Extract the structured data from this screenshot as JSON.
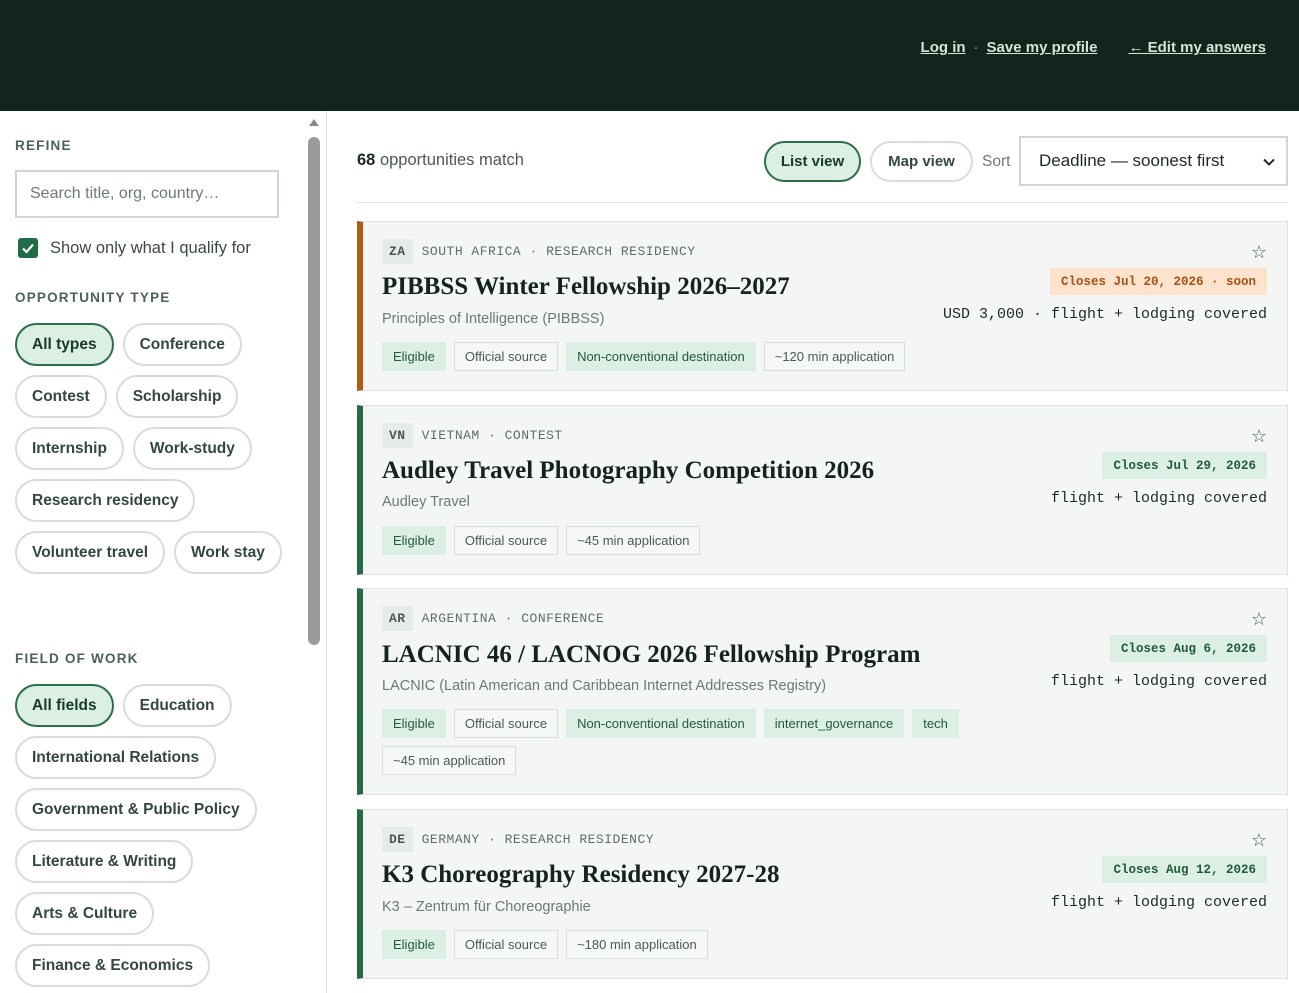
{
  "header": {
    "login": "Log in",
    "save_profile": "Save my profile",
    "edit_answers": "← Edit my answers",
    "separator": "·"
  },
  "sidebar": {
    "refine_label": "REFINE",
    "search_placeholder": "Search title, org, country…",
    "qualify_label": "Show only what I qualify for",
    "qualify_checked": true,
    "type_label": "OPPORTUNITY TYPE",
    "types": [
      "All types",
      "Conference",
      "Contest",
      "Scholarship",
      "Internship",
      "Work-study",
      "Research residency",
      "Volunteer travel",
      "Work stay"
    ],
    "field_label": "FIELD OF WORK",
    "fields": [
      "All fields",
      "Education",
      "International Relations",
      "Government & Public Policy",
      "Literature & Writing",
      "Arts & Culture",
      "Finance & Economics"
    ]
  },
  "main": {
    "count": "68",
    "count_suffix": "opportunities match",
    "list_view": "List view",
    "map_view": "Map view",
    "sort_label": "Sort",
    "sort_value": "Deadline — soonest first"
  },
  "cards": [
    {
      "cc": "ZA",
      "meta": "SOUTH AFRICA · RESEARCH RESIDENCY",
      "title": "PIBBSS Winter Fellowship 2026–2027",
      "org": "Principles of Intelligence (PIBBSS)",
      "closes": "Closes Jul 20, 2026 · soon",
      "funding": "USD 3,000 · flight + lodging covered",
      "tags": [
        "Eligible",
        "Official source",
        "Non-conventional destination",
        "~120 min application"
      ]
    },
    {
      "cc": "VN",
      "meta": "VIETNAM · CONTEST",
      "title": "Audley Travel Photography Competition 2026",
      "org": "Audley Travel",
      "closes": "Closes Jul 29, 2026",
      "funding": "flight + lodging covered",
      "tags": [
        "Eligible",
        "Official source",
        "~45 min application"
      ]
    },
    {
      "cc": "AR",
      "meta": "ARGENTINA · CONFERENCE",
      "title": "LACNIC 46 / LACNOG 2026 Fellowship Program",
      "org": "LACNIC (Latin American and Caribbean Internet Addresses Registry)",
      "closes": "Closes Aug 6, 2026",
      "funding": "flight + lodging covered",
      "tags": [
        "Eligible",
        "Official source",
        "Non-conventional destination",
        "internet_governance",
        "tech",
        "~45 min application"
      ]
    },
    {
      "cc": "DE",
      "meta": "GERMANY · RESEARCH RESIDENCY",
      "title": "K3 Choreography Residency 2027-28",
      "org": "K3 – Zentrum für Choreographie",
      "closes": "Closes Aug 12, 2026",
      "funding": "flight + lodging covered",
      "tags": [
        "Eligible",
        "Official source",
        "~180 min application"
      ]
    }
  ],
  "colors": {
    "header_bg": "#13241d",
    "accent": "#236a45",
    "soon": "#b35a17",
    "chip_active_bg": "#dcefe4"
  }
}
